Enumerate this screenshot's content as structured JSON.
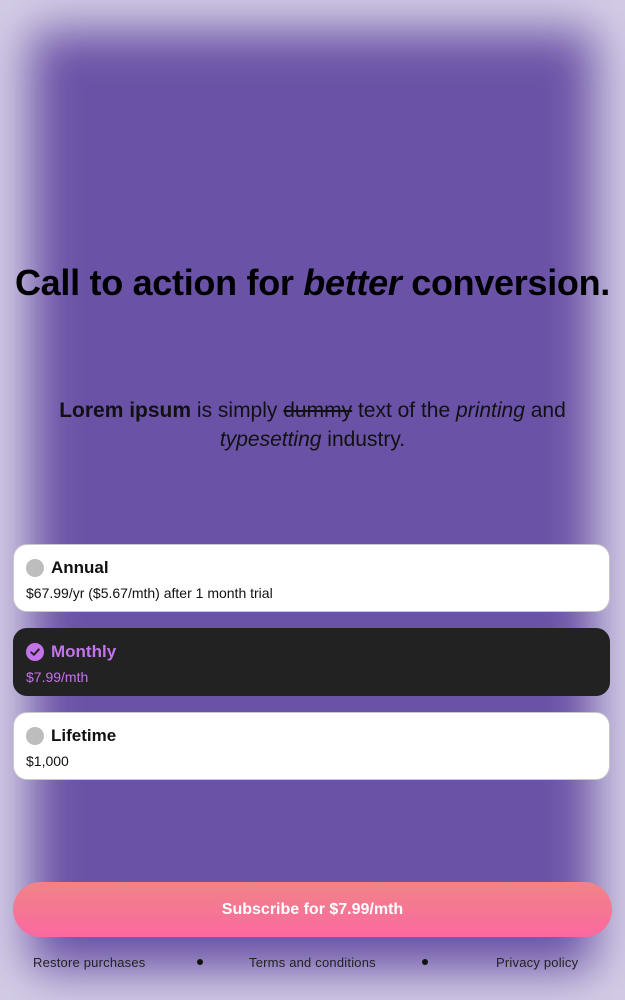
{
  "headline": {
    "before": "Call to action for ",
    "emphasis": "better",
    "after": " conversion."
  },
  "description": {
    "bold": "Lorem ipsum",
    "text1": " is simply ",
    "strike": "dummy",
    "text2": " text of the ",
    "italic1": "printing",
    "text3": " and ",
    "italic2": "typesetting",
    "text4": " industry."
  },
  "plans": [
    {
      "title": "Annual",
      "price": "$67.99/yr ($5.67/mth) after 1 month trial",
      "selected": false
    },
    {
      "title": "Monthly",
      "price": "$7.99/mth",
      "selected": true
    },
    {
      "title": "Lifetime",
      "price": "$1,000",
      "selected": false
    }
  ],
  "cta": {
    "label": "Subscribe for $7.99/mth"
  },
  "footer": {
    "restore": "Restore purchases",
    "terms": "Terms and conditions",
    "privacy": "Privacy policy"
  },
  "colors": {
    "background": "#6a52a6",
    "selected_card": "#222222",
    "accent": "#c474ea",
    "cta_top": "#f08486",
    "cta_bottom": "#fb69a0"
  }
}
